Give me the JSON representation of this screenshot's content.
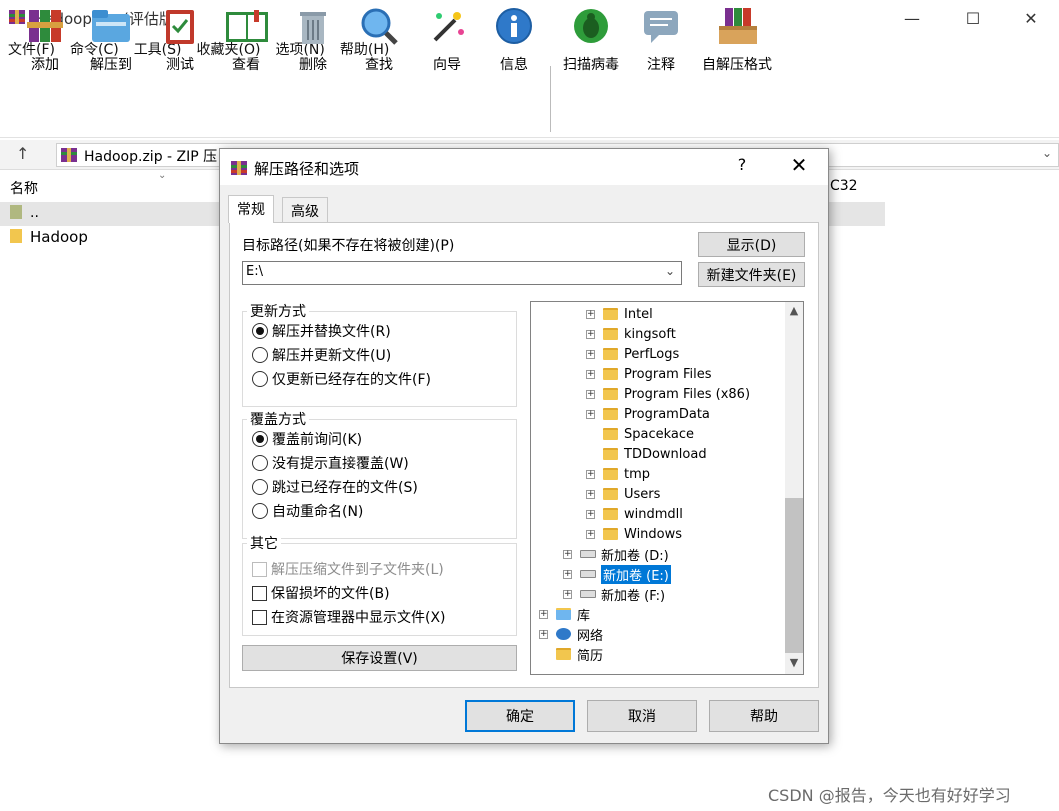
{
  "window": {
    "title": "Hadoop.zip (评估版本)",
    "minimize": "—",
    "maximize": "☐",
    "close": "✕"
  },
  "menu": [
    "文件(F)",
    "命令(C)",
    "工具(S)",
    "收藏夹(O)",
    "选项(N)",
    "帮助(H)"
  ],
  "toolbar": {
    "add": "添加",
    "extract_to": "解压到",
    "test": "测试",
    "view": "查看",
    "delete": "删除",
    "find": "查找",
    "wizard": "向导",
    "info": "信息",
    "virus_scan": "扫描病毒",
    "comment": "注释",
    "sfx": "自解压格式"
  },
  "address": {
    "text": "Hadoop.zip - ZIP 压"
  },
  "filelist": {
    "col_name": "名称",
    "col_crc": "C32",
    "rows": [
      "..",
      "Hadoop"
    ]
  },
  "dialog": {
    "title": "解压路径和选项",
    "help": "?",
    "close": "✕",
    "tabs": [
      "常规",
      "高级"
    ],
    "dest_label": "目标路径(如果不存在将被创建)(P)",
    "dest_value": "E:\\",
    "show_button": "显示(D)",
    "new_folder_button": "新建文件夹(E)",
    "update_group": {
      "title": "更新方式",
      "options": [
        "解压并替换文件(R)",
        "解压并更新文件(U)",
        "仅更新已经存在的文件(F)"
      ]
    },
    "overwrite_group": {
      "title": "覆盖方式",
      "options": [
        "覆盖前询问(K)",
        "没有提示直接覆盖(W)",
        "跳过已经存在的文件(S)",
        "自动重命名(N)"
      ]
    },
    "misc_group": {
      "title": "其它",
      "options": [
        "解压压缩文件到子文件夹(L)",
        "保留损坏的文件(B)",
        "在资源管理器中显示文件(X)"
      ]
    },
    "save_settings": "保存设置(V)",
    "tree": [
      "Intel",
      "kingsoft",
      "PerfLogs",
      "Program Files",
      "Program Files (x86)",
      "ProgramData",
      "Spacekace",
      "TDDownload",
      "tmp",
      "Users",
      "windmdll",
      "Windows",
      "新加卷 (D:)",
      "新加卷 (E:)",
      "新加卷 (F:)",
      "库",
      "网络",
      "简历"
    ],
    "scroll_up": "▲",
    "scroll_down": "▼",
    "ok": "确定",
    "cancel": "取消",
    "help_button": "帮助"
  },
  "watermark": "CSDN @报告，今天也有好好学习",
  "colors": {
    "selection": "#0078d7",
    "folder": "#f2c64e"
  }
}
